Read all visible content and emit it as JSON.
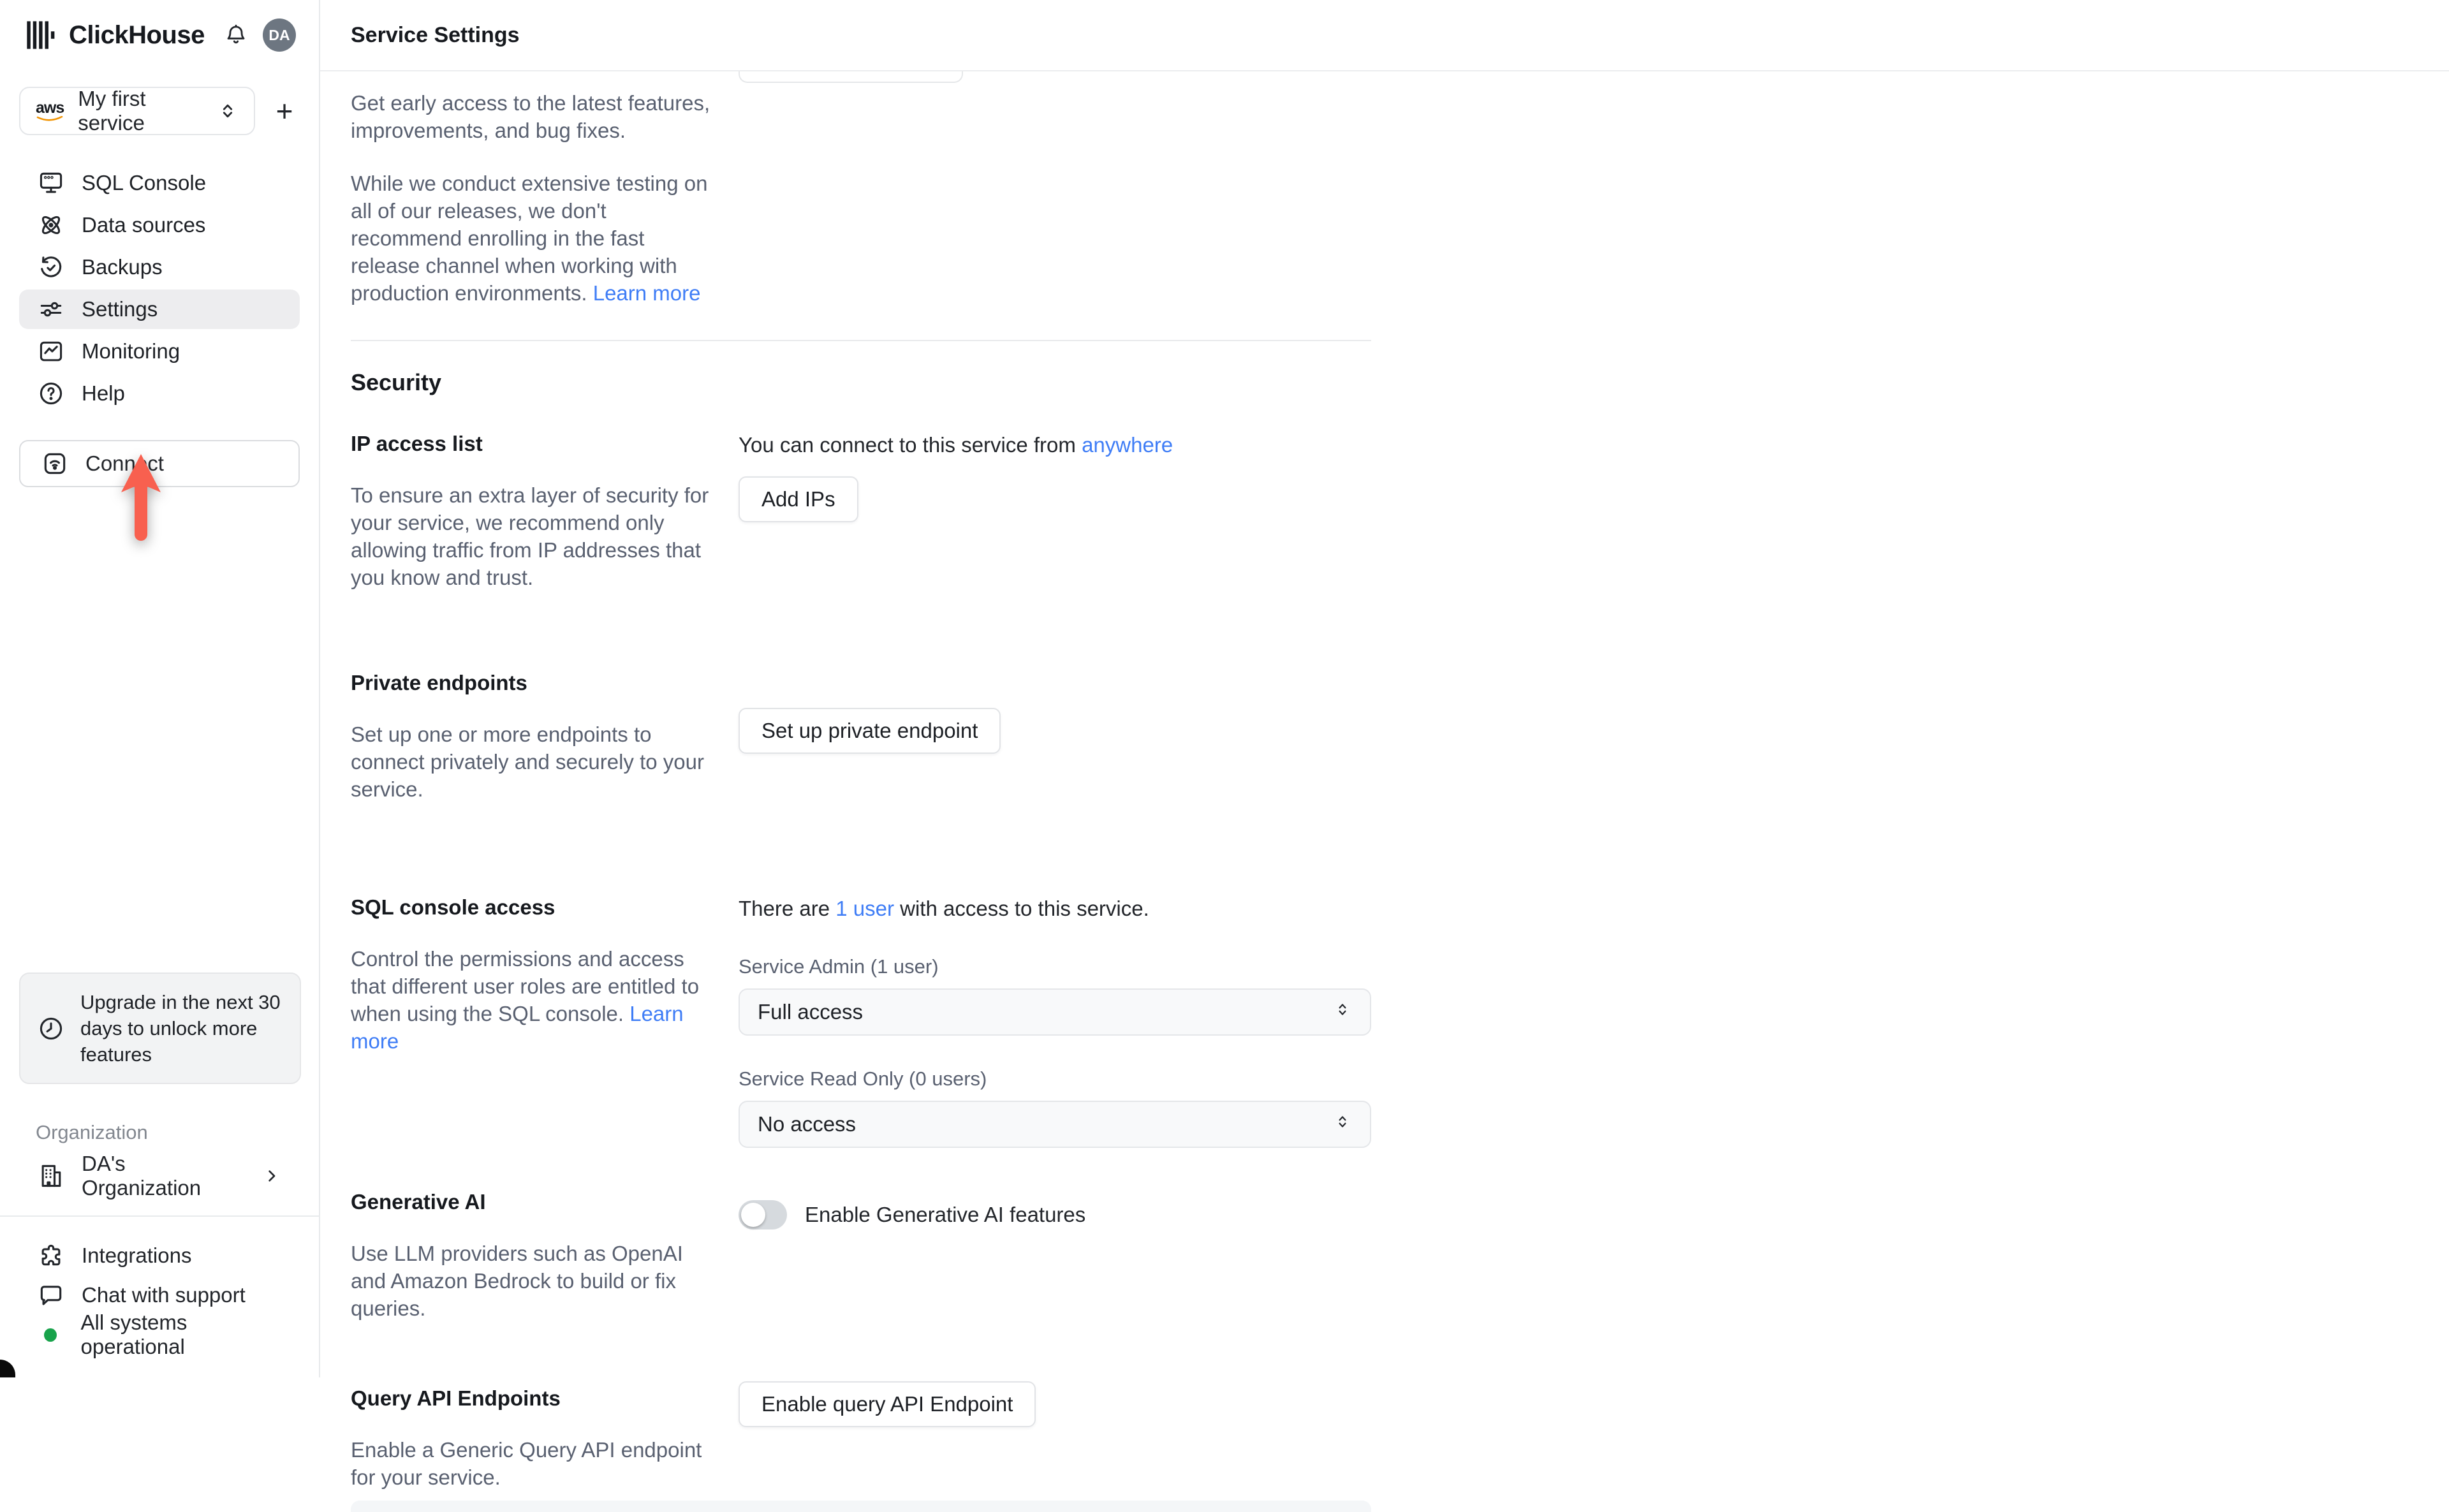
{
  "header": {
    "title": "Service Settings"
  },
  "sidebar": {
    "brand": "ClickHouse",
    "avatar_initials": "DA",
    "service_selector": {
      "provider": "aws",
      "label": "My first service"
    },
    "add_service_label": "+",
    "nav": [
      {
        "label": "SQL Console"
      },
      {
        "label": "Data sources"
      },
      {
        "label": "Backups"
      },
      {
        "label": "Settings"
      },
      {
        "label": "Monitoring"
      },
      {
        "label": "Help"
      }
    ],
    "connect_label": "Connect",
    "upgrade_notice": "Upgrade in the next 30 days to unlock more features",
    "organization_heading": "Organization",
    "organization_name": "DA's Organization",
    "footer": [
      {
        "label": "Integrations"
      },
      {
        "label": "Chat with support"
      },
      {
        "label": "All systems operational"
      }
    ]
  },
  "release_channel": {
    "intro": "Get early access to the latest features, improvements, and bug fixes.",
    "warning": "While we conduct extensive testing on all of our releases, we don't recommend enrolling in the fast release channel when working with production environments. ",
    "learn_more": "Learn more"
  },
  "security": {
    "heading": "Security",
    "ip_access": {
      "heading": "IP access list",
      "connect_prefix": "You can connect to this service from ",
      "connect_link": "anywhere",
      "add_ips_button": "Add IPs",
      "description": "To ensure an extra layer of security for your service, we recommend only allowing traffic from IP addresses that you know and trust."
    },
    "private_endpoints": {
      "heading": "Private endpoints",
      "description": "Set up one or more endpoints to connect privately and securely to your service.",
      "button": "Set up private endpoint"
    },
    "sql_console_access": {
      "heading": "SQL console access",
      "description": "Control the permissions and access that different user roles are entitled to when using the SQL console. ",
      "learn_more": "Learn more",
      "summary_prefix": "There are ",
      "summary_link": "1 user",
      "summary_suffix": " with access to this service.",
      "admin_label": "Service Admin (1 user)",
      "admin_value": "Full access",
      "readonly_label": "Service Read Only (0 users)",
      "readonly_value": "No access"
    },
    "generative_ai": {
      "heading": "Generative AI",
      "description": "Use LLM providers such as OpenAI and Amazon Bedrock to build or fix queries.",
      "toggle_label": "Enable Generative AI features",
      "toggle_state": "off"
    },
    "query_api": {
      "heading": "Query API Endpoints",
      "description": "Enable a Generic Query API endpoint for your service.",
      "button": "Enable query API Endpoint"
    }
  },
  "colors": {
    "arrow": "#f8604f",
    "link": "#3f7df6",
    "status_green": "#18a34b",
    "avatar_bg": "#6d7681",
    "aws_orange": "#f19300"
  }
}
